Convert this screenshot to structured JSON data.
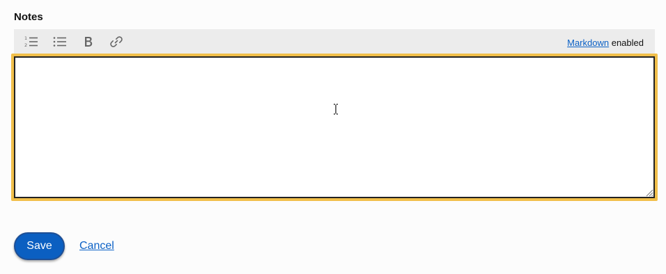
{
  "form": {
    "label": "Notes",
    "notes_value": ""
  },
  "toolbar": {
    "buttons": [
      {
        "icon": "numbered-list-icon"
      },
      {
        "icon": "bulleted-list-icon"
      },
      {
        "icon": "bold-icon"
      },
      {
        "icon": "link-icon"
      }
    ],
    "markdown_link": "Markdown",
    "markdown_suffix": "enabled"
  },
  "actions": {
    "save_label": "Save",
    "cancel_label": "Cancel"
  },
  "colors": {
    "focus_ring": "#f1bf4a",
    "primary": "#0b5fc1",
    "link": "#0b61c6",
    "toolbar_bg": "#ececec"
  }
}
